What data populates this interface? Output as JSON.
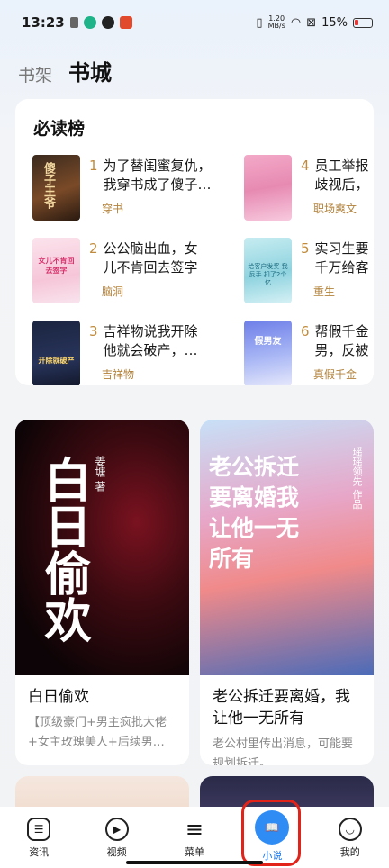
{
  "status": {
    "time": "13:23",
    "speed_top": "1.20",
    "speed_bottom": "MB/s",
    "battery": "15%"
  },
  "tabs": {
    "bookshelf": "书架",
    "store": "书城"
  },
  "ranking": {
    "title": "必读榜",
    "items": [
      {
        "num": "1",
        "title_l1": "为了替闺蜜复仇，",
        "title_l2": "我穿书成了傻子…",
        "tag": "穿书",
        "cover_text": "傻子王爷"
      },
      {
        "num": "2",
        "title_l1": "公公脑出血，女",
        "title_l2": "儿不肯回去签字",
        "tag": "脑洞",
        "cover_text": "女儿不肯回去签字"
      },
      {
        "num": "3",
        "title_l1": "吉祥物说我开除",
        "title_l2": "他就会破产，…",
        "tag": "吉祥物",
        "cover_text": "开除就破产"
      },
      {
        "num": "4",
        "title_l1": "员工举报",
        "title_l2": "歧视后，",
        "tag": "职场爽文"
      },
      {
        "num": "5",
        "title_l1": "实习生要",
        "title_l2": "千万给客",
        "tag": "重生",
        "cover_text": "给客户发奖 我反手 扣了2个亿"
      },
      {
        "num": "6",
        "title_l1": "帮假千金",
        "title_l2": "男，反被",
        "tag": "真假千金",
        "cover_text": "假男友"
      }
    ]
  },
  "cards": [
    {
      "title": "白日偷欢",
      "desc": "【顶级豪门+男主疯批大佬+女主玫瑰美人+后续男…",
      "cover_title": "白日偷欢",
      "cover_author": "姜塘 著"
    },
    {
      "title": "老公拆迁要离婚，我让他一无所有",
      "desc": "老公村里传出消息，可能要规划拆迁。…",
      "cover_title": "老公拆迁要离婚我让他一无所有",
      "cover_author": "瑶瑶领先 作品"
    }
  ],
  "nav": [
    {
      "label": "资讯",
      "icon": "news-icon"
    },
    {
      "label": "视频",
      "icon": "play-icon"
    },
    {
      "label": "菜单",
      "icon": "menu-icon"
    },
    {
      "label": "小说",
      "icon": "book-icon"
    },
    {
      "label": "我的",
      "icon": "smile-icon"
    }
  ],
  "colors": {
    "accent": "#2f8cf5",
    "tag": "#b3823a",
    "highlight_ring": "#e2231a"
  }
}
